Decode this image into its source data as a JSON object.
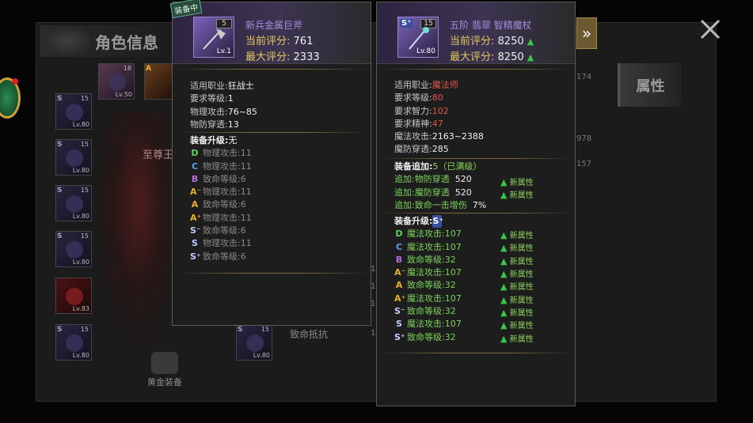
{
  "background": {
    "title": "角色信息",
    "attr_tab": "属性",
    "gold_equip_label": "黄金装备",
    "faded_texts": [
      "至尊王",
      "致命抵抗"
    ],
    "faded_nums": [
      "174",
      "978",
      "157",
      "1",
      "1",
      "1",
      "1",
      "1",
      "1",
      "1",
      "1"
    ],
    "slots": [
      {
        "grade": "S",
        "num": "15",
        "lv": "Lv.80"
      },
      {
        "grade": "S",
        "num": "15",
        "lv": "Lv.80"
      },
      {
        "grade": "S",
        "num": "15",
        "lv": "Lv.80"
      },
      {
        "grade": "S",
        "num": "15",
        "lv": "Lv.80"
      },
      {
        "grade": "",
        "num": "",
        "lv": "Lv.83"
      },
      {
        "grade": "S",
        "num": "15",
        "lv": "Lv.80"
      },
      {
        "grade": "",
        "num": "18",
        "lv": "Lv.50"
      },
      {
        "grade": "A",
        "num": "",
        "lv": ""
      },
      {
        "grade": "S",
        "num": "15",
        "lv": "Lv.80"
      }
    ]
  },
  "left_panel": {
    "equipped_tag": "装备中",
    "item_name": "新兵金属巨斧",
    "icon": {
      "badge": "5",
      "level": "Lv.1",
      "grade": ""
    },
    "current_score_label": "当前评分:",
    "current_score": "761",
    "max_score_label": "最大评分:",
    "max_score": "2333",
    "stats": [
      {
        "label": "适用职业:",
        "value": "狂战士"
      },
      {
        "label": "要求等级:",
        "value": "1"
      },
      {
        "label": "物理攻击:",
        "value": "76~85"
      },
      {
        "label": "物防穿透:",
        "value": "13"
      }
    ],
    "upgrade_title": "装备升级:",
    "upgrade_value": "无",
    "upgrades": [
      {
        "grade": "D",
        "text": "物理攻击:11"
      },
      {
        "grade": "C",
        "text": "物理攻击:11"
      },
      {
        "grade": "B",
        "text": "致命等级:6"
      },
      {
        "grade": "A⁻",
        "text": "物理攻击:11"
      },
      {
        "grade": "A",
        "text": "致命等级:6"
      },
      {
        "grade": "A⁺",
        "text": "物理攻击:11"
      },
      {
        "grade": "S⁻",
        "text": "致命等级:6"
      },
      {
        "grade": "S",
        "text": "物理攻击:11"
      },
      {
        "grade": "S⁺",
        "text": "致命等级:6"
      }
    ]
  },
  "right_panel": {
    "item_name": "五阶 翡翠 智精魔杖",
    "icon": {
      "badge": "15",
      "level": "Lv.80",
      "grade": "S⁺"
    },
    "current_score_label": "当前评分:",
    "current_score": "8250",
    "max_score_label": "最大评分:",
    "max_score": "8250",
    "stats": [
      {
        "label": "适用职业:",
        "value": "魔法师",
        "red": true
      },
      {
        "label": "要求等级:",
        "value": "80",
        "red": true
      },
      {
        "label": "要求智力:",
        "value": "102",
        "red": true
      },
      {
        "label": "要求精神:",
        "value": "47",
        "red": true
      },
      {
        "label": "魔法攻击:",
        "value": "2163~2388",
        "red": false
      },
      {
        "label": "魔防穿透:",
        "value": "285",
        "red": false
      }
    ],
    "addon_title": "装备追加:",
    "addon_value": "5（已满级）",
    "addons": [
      {
        "label": "追加:物防穿透",
        "value": "520",
        "new": "新属性"
      },
      {
        "label": "追加:魔防穿透",
        "value": "520",
        "new": "新属性"
      },
      {
        "label": "追加:致命一击增伤",
        "value": "7%",
        "new": ""
      }
    ],
    "upgrade_title": "装备升级:",
    "upgrade_grade": "S⁺",
    "upgrades": [
      {
        "grade": "D",
        "text": "魔法攻击:107",
        "new": "新属性"
      },
      {
        "grade": "C",
        "text": "魔法攻击:107",
        "new": "新属性"
      },
      {
        "grade": "B",
        "text": "致命等级:32",
        "new": "新属性"
      },
      {
        "grade": "A⁻",
        "text": "魔法攻击:107",
        "new": "新属性"
      },
      {
        "grade": "A",
        "text": "致命等级:32",
        "new": "新属性"
      },
      {
        "grade": "A⁺",
        "text": "魔法攻击:107",
        "new": "新属性"
      },
      {
        "grade": "S⁻",
        "text": "致命等级:32",
        "new": "新属性"
      },
      {
        "grade": "S",
        "text": "魔法攻击:107",
        "new": "新属性"
      },
      {
        "grade": "S⁺",
        "text": "致命等级:32",
        "new": "新属性"
      }
    ]
  }
}
